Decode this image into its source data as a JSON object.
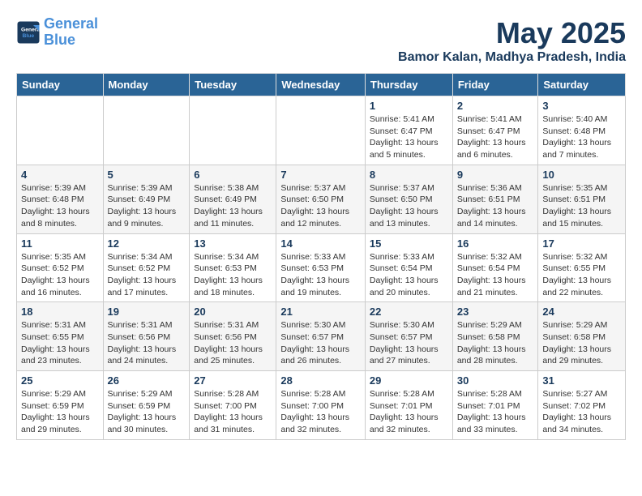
{
  "header": {
    "logo_line1": "General",
    "logo_line2": "Blue",
    "month_year": "May 2025",
    "location": "Bamor Kalan, Madhya Pradesh, India"
  },
  "weekdays": [
    "Sunday",
    "Monday",
    "Tuesday",
    "Wednesday",
    "Thursday",
    "Friday",
    "Saturday"
  ],
  "weeks": [
    [
      {
        "day": "",
        "info": ""
      },
      {
        "day": "",
        "info": ""
      },
      {
        "day": "",
        "info": ""
      },
      {
        "day": "",
        "info": ""
      },
      {
        "day": "1",
        "info": "Sunrise: 5:41 AM\nSunset: 6:47 PM\nDaylight: 13 hours\nand 5 minutes."
      },
      {
        "day": "2",
        "info": "Sunrise: 5:41 AM\nSunset: 6:47 PM\nDaylight: 13 hours\nand 6 minutes."
      },
      {
        "day": "3",
        "info": "Sunrise: 5:40 AM\nSunset: 6:48 PM\nDaylight: 13 hours\nand 7 minutes."
      }
    ],
    [
      {
        "day": "4",
        "info": "Sunrise: 5:39 AM\nSunset: 6:48 PM\nDaylight: 13 hours\nand 8 minutes."
      },
      {
        "day": "5",
        "info": "Sunrise: 5:39 AM\nSunset: 6:49 PM\nDaylight: 13 hours\nand 9 minutes."
      },
      {
        "day": "6",
        "info": "Sunrise: 5:38 AM\nSunset: 6:49 PM\nDaylight: 13 hours\nand 11 minutes."
      },
      {
        "day": "7",
        "info": "Sunrise: 5:37 AM\nSunset: 6:50 PM\nDaylight: 13 hours\nand 12 minutes."
      },
      {
        "day": "8",
        "info": "Sunrise: 5:37 AM\nSunset: 6:50 PM\nDaylight: 13 hours\nand 13 minutes."
      },
      {
        "day": "9",
        "info": "Sunrise: 5:36 AM\nSunset: 6:51 PM\nDaylight: 13 hours\nand 14 minutes."
      },
      {
        "day": "10",
        "info": "Sunrise: 5:35 AM\nSunset: 6:51 PM\nDaylight: 13 hours\nand 15 minutes."
      }
    ],
    [
      {
        "day": "11",
        "info": "Sunrise: 5:35 AM\nSunset: 6:52 PM\nDaylight: 13 hours\nand 16 minutes."
      },
      {
        "day": "12",
        "info": "Sunrise: 5:34 AM\nSunset: 6:52 PM\nDaylight: 13 hours\nand 17 minutes."
      },
      {
        "day": "13",
        "info": "Sunrise: 5:34 AM\nSunset: 6:53 PM\nDaylight: 13 hours\nand 18 minutes."
      },
      {
        "day": "14",
        "info": "Sunrise: 5:33 AM\nSunset: 6:53 PM\nDaylight: 13 hours\nand 19 minutes."
      },
      {
        "day": "15",
        "info": "Sunrise: 5:33 AM\nSunset: 6:54 PM\nDaylight: 13 hours\nand 20 minutes."
      },
      {
        "day": "16",
        "info": "Sunrise: 5:32 AM\nSunset: 6:54 PM\nDaylight: 13 hours\nand 21 minutes."
      },
      {
        "day": "17",
        "info": "Sunrise: 5:32 AM\nSunset: 6:55 PM\nDaylight: 13 hours\nand 22 minutes."
      }
    ],
    [
      {
        "day": "18",
        "info": "Sunrise: 5:31 AM\nSunset: 6:55 PM\nDaylight: 13 hours\nand 23 minutes."
      },
      {
        "day": "19",
        "info": "Sunrise: 5:31 AM\nSunset: 6:56 PM\nDaylight: 13 hours\nand 24 minutes."
      },
      {
        "day": "20",
        "info": "Sunrise: 5:31 AM\nSunset: 6:56 PM\nDaylight: 13 hours\nand 25 minutes."
      },
      {
        "day": "21",
        "info": "Sunrise: 5:30 AM\nSunset: 6:57 PM\nDaylight: 13 hours\nand 26 minutes."
      },
      {
        "day": "22",
        "info": "Sunrise: 5:30 AM\nSunset: 6:57 PM\nDaylight: 13 hours\nand 27 minutes."
      },
      {
        "day": "23",
        "info": "Sunrise: 5:29 AM\nSunset: 6:58 PM\nDaylight: 13 hours\nand 28 minutes."
      },
      {
        "day": "24",
        "info": "Sunrise: 5:29 AM\nSunset: 6:58 PM\nDaylight: 13 hours\nand 29 minutes."
      }
    ],
    [
      {
        "day": "25",
        "info": "Sunrise: 5:29 AM\nSunset: 6:59 PM\nDaylight: 13 hours\nand 29 minutes."
      },
      {
        "day": "26",
        "info": "Sunrise: 5:29 AM\nSunset: 6:59 PM\nDaylight: 13 hours\nand 30 minutes."
      },
      {
        "day": "27",
        "info": "Sunrise: 5:28 AM\nSunset: 7:00 PM\nDaylight: 13 hours\nand 31 minutes."
      },
      {
        "day": "28",
        "info": "Sunrise: 5:28 AM\nSunset: 7:00 PM\nDaylight: 13 hours\nand 32 minutes."
      },
      {
        "day": "29",
        "info": "Sunrise: 5:28 AM\nSunset: 7:01 PM\nDaylight: 13 hours\nand 32 minutes."
      },
      {
        "day": "30",
        "info": "Sunrise: 5:28 AM\nSunset: 7:01 PM\nDaylight: 13 hours\nand 33 minutes."
      },
      {
        "day": "31",
        "info": "Sunrise: 5:27 AM\nSunset: 7:02 PM\nDaylight: 13 hours\nand 34 minutes."
      }
    ]
  ]
}
